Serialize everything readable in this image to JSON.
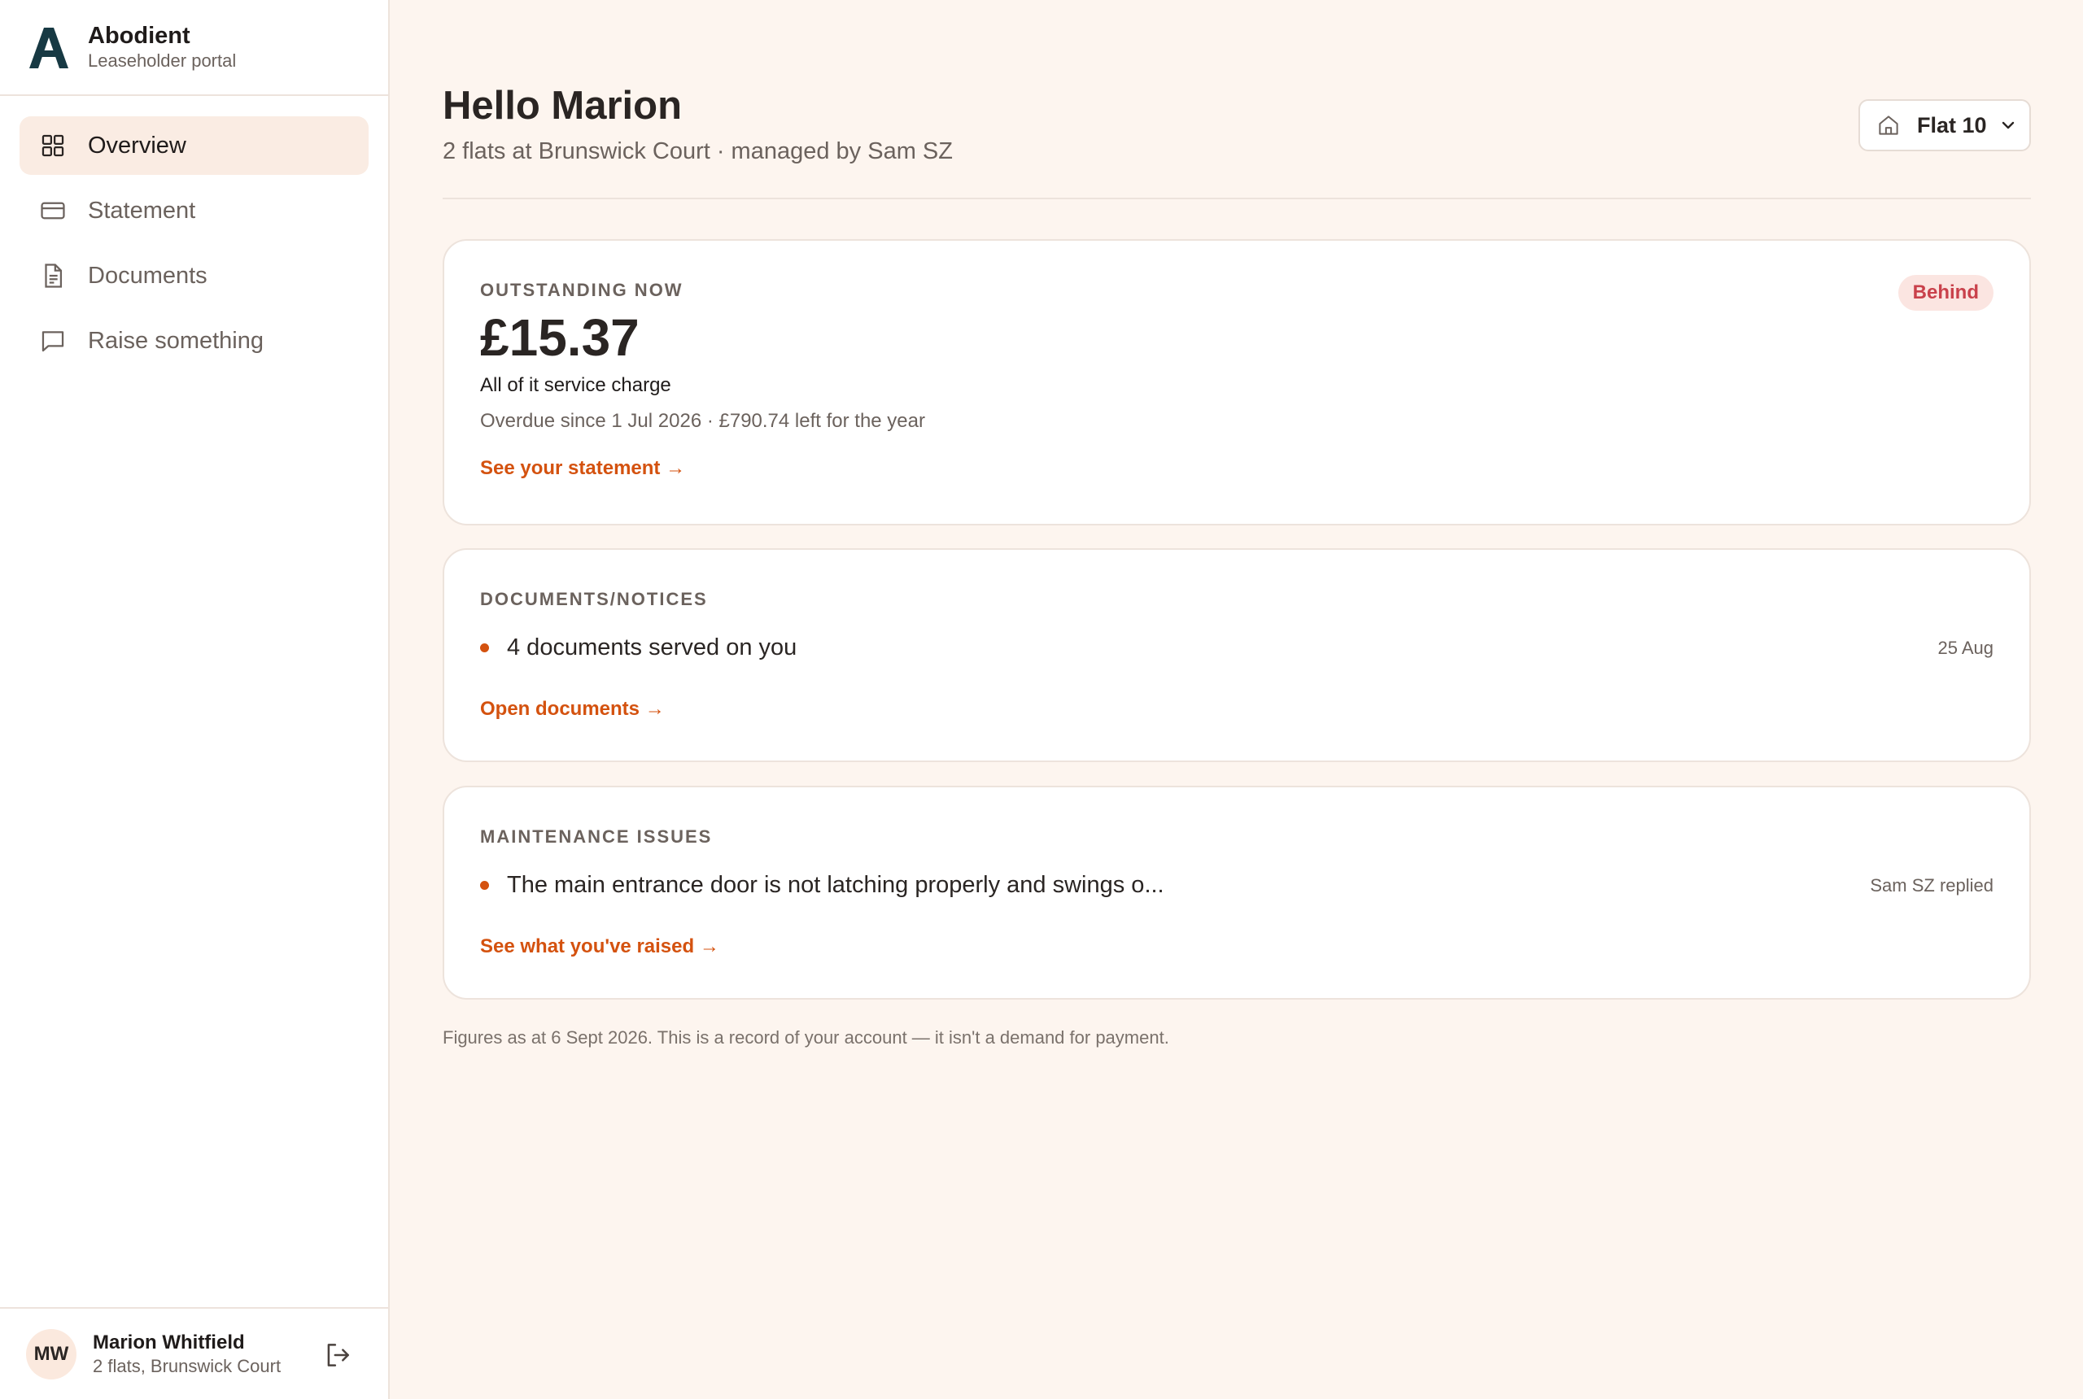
{
  "brand": {
    "name": "Abodient",
    "subtitle": "Leaseholder portal",
    "color": "#173943"
  },
  "nav": {
    "items": [
      {
        "label": "Overview",
        "icon": "grid-icon",
        "active": true
      },
      {
        "label": "Statement",
        "icon": "card-icon",
        "active": false
      },
      {
        "label": "Documents",
        "icon": "document-icon",
        "active": false
      },
      {
        "label": "Raise something",
        "icon": "message-icon",
        "active": false
      }
    ]
  },
  "user": {
    "initials": "MW",
    "name": "Marion Whitfield",
    "subtitle": "2 flats, Brunswick Court",
    "logout_icon": "logout-icon"
  },
  "header": {
    "greeting": "Hello Marion",
    "subtitle": "2 flats at Brunswick Court · managed by Sam SZ",
    "flat_select": {
      "value": "Flat 10",
      "icon": "home-icon"
    }
  },
  "outstanding": {
    "label": "OUTSTANDING NOW",
    "amount": "£15.37",
    "breakdown": "All of it service charge",
    "detail": "Overdue since 1 Jul 2026 · £790.74 left for the year",
    "link": "See your statement →",
    "badge": "Behind"
  },
  "documents": {
    "label": "DOCUMENTS/NOTICES",
    "item": "4 documents served on you",
    "date": "25 Aug",
    "link": "Open documents →"
  },
  "maintenance": {
    "label": "MAINTENANCE ISSUES",
    "item": "The main entrance door is not latching properly and swings o...",
    "meta": "Sam SZ replied",
    "link": "See what you've raised →"
  },
  "footnote": "Figures as at 6 Sept 2026. This is a record of your account — it isn't a demand for payment.",
  "colors": {
    "accent": "#d4520f",
    "background": "#fdf5ef",
    "badge_text": "#c9414b",
    "badge_bg": "#fbe5e1"
  }
}
